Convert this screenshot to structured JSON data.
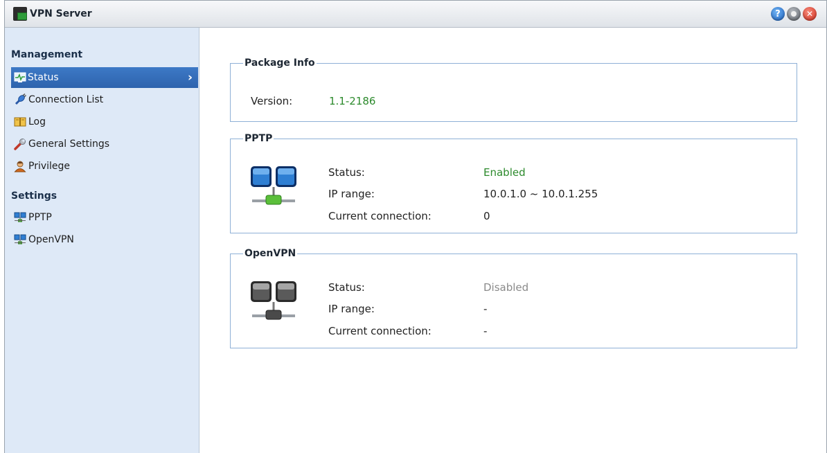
{
  "window": {
    "title": "VPN Server"
  },
  "sidebar": {
    "management_title": "Management",
    "management_items": [
      {
        "label": "Status",
        "icon": "status-monitor-icon",
        "active": true
      },
      {
        "label": "Connection List",
        "icon": "plug-icon"
      },
      {
        "label": "Log",
        "icon": "book-icon"
      },
      {
        "label": "General Settings",
        "icon": "wrench-icon"
      },
      {
        "label": "Privilege",
        "icon": "user-icon"
      }
    ],
    "settings_title": "Settings",
    "settings_items": [
      {
        "label": "PPTP",
        "icon": "network-icon"
      },
      {
        "label": "OpenVPN",
        "icon": "network-icon"
      }
    ]
  },
  "package_info": {
    "title": "Package Info",
    "version_label": "Version:",
    "version_value": "1.1-2186"
  },
  "pptp": {
    "title": "PPTP",
    "status_label": "Status:",
    "status_value": "Enabled",
    "ip_label": "IP range:",
    "ip_value": "10.0.1.0 ~ 10.0.1.255",
    "conn_label": "Current connection:",
    "conn_value": "0",
    "icon_color": "#2f7fd3"
  },
  "openvpn": {
    "title": "OpenVPN",
    "status_label": "Status:",
    "status_value": "Disabled",
    "ip_label": "IP range:",
    "ip_value": "-",
    "conn_label": "Current connection:",
    "conn_value": "-",
    "icon_color": "#5a5a5a"
  },
  "colors": {
    "enabled": "#2c8a2c",
    "disabled": "#8a8a8a",
    "accent": "#2d63ad"
  }
}
